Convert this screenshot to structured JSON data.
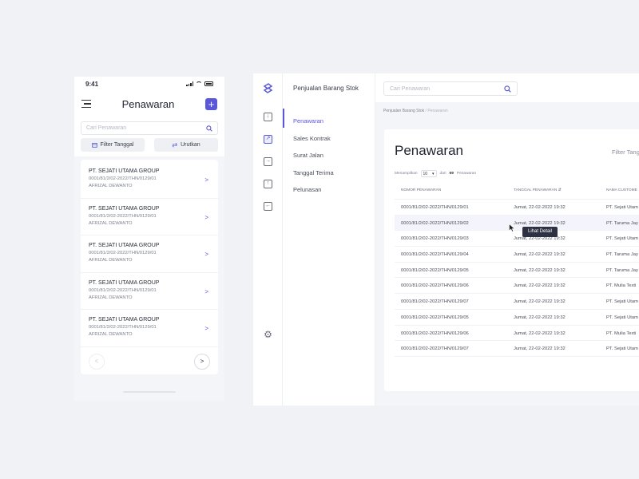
{
  "mobile": {
    "status_time": "9:41",
    "title": "Penawaran",
    "add_symbol": "+",
    "search_placeholder": "Cari Penawaran",
    "filter_label": "Filter Tanggal",
    "sort_label": "Urutkan",
    "items": [
      {
        "company": "PT. SEJATI UTAMA GROUP",
        "number": "0001/81/2/02-2022/THN/0129/01",
        "person": "AFRIZAL DEWANTO"
      },
      {
        "company": "PT. SEJATI UTAMA GROUP",
        "number": "0001/81/2/02-2022/THN/0129/01",
        "person": "AFRIZAL DEWANTO"
      },
      {
        "company": "PT. SEJATI UTAMA GROUP",
        "number": "0001/81/2/02-2022/THN/0129/01",
        "person": "AFRIZAL DEWANTO"
      },
      {
        "company": "PT. SEJATI UTAMA GROUP",
        "number": "0001/81/2/02-2022/THN/0129/01",
        "person": "AFRIZAL DEWANTO"
      },
      {
        "company": "PT. SEJATI UTAMA GROUP",
        "number": "0001/81/2/02-2022/THN/0129/01",
        "person": "AFRIZAL DEWANTO"
      }
    ]
  },
  "desktop": {
    "app_title": "Penjualan Barang Stok",
    "search_placeholder": "Cari Penawaran",
    "nav": [
      "Penawaran",
      "Sales Kontrak",
      "Surat Jalan",
      "Tanggal Terima",
      "Pelunasan"
    ],
    "active_nav": "Penawaran",
    "breadcrumb": {
      "parent": "Penjualan Barang Stok",
      "separator": "/",
      "current": "Penawaran"
    },
    "page_title": "Penawaran",
    "filter_label": "Filter Tangg",
    "show_prefix": "Menampilkan",
    "page_size": "10",
    "show_middle": "dari",
    "total": "69",
    "show_suffix": "Penawaran",
    "columns": [
      "NOMOR PENAWARAN",
      "TANGGAL PENAWARAN",
      "NAMA CUSTOME"
    ],
    "rows": [
      [
        "0001/81/2/02-2022/THN/0129/01",
        "Jumat, 22-02-2022 19:32",
        "PT. Sejati Utam"
      ],
      [
        "0001/81/2/02-2022/THN/0129/02",
        "Jumat, 22-02-2022 19:32",
        "PT. Taruma Jay"
      ],
      [
        "0001/81/2/02-2022/THN/0129/03",
        "Jumat, 22-02-2022 19:32",
        "PT. Sejati Utam"
      ],
      [
        "0001/81/2/02-2022/THN/0129/04",
        "Jumat, 22-02-2022 19:32",
        "PT. Taruma Jay"
      ],
      [
        "0001/81/2/02-2022/THN/0129/05",
        "Jumat, 22-02-2022 19:32",
        "PT. Taruma Jay"
      ],
      [
        "0001/81/2/02-2022/THN/0129/06",
        "Jumat, 22-02-2022 19:32",
        "PT. Mulia Texti"
      ],
      [
        "0001/81/2/02-2022/THN/0129/07",
        "Jumat, 22-02-2022 19:32",
        "PT. Sejati Utam"
      ],
      [
        "0001/81/2/02-2022/THN/0129/05",
        "Jumat, 22-02-2022 19:32",
        "PT. Sejati Utam"
      ],
      [
        "0001/81/2/02-2022/THN/0129/06",
        "Jumat, 22-02-2022 19:32",
        "PT. Mulia Texti"
      ],
      [
        "0001/81/2/02-2022/THN/0129/07",
        "Jumat, 22-02-2022 19:32",
        "PT. Sejati Utam"
      ]
    ],
    "tooltip": "Lihat Detail"
  },
  "colors": {
    "accent": "#5b57d9",
    "background": "#f0f2f6",
    "tooltip": "#2d3142"
  }
}
